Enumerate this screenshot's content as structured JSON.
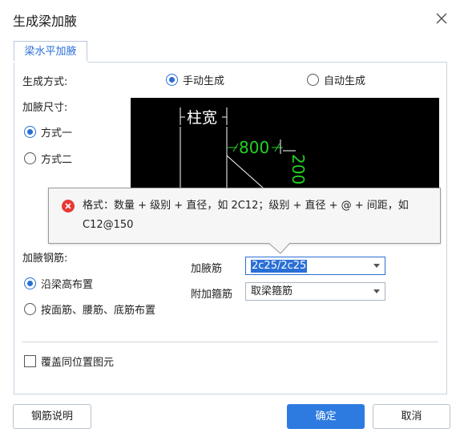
{
  "window": {
    "title": "生成梁加腋"
  },
  "tab": {
    "label": "梁水平加腋"
  },
  "generation": {
    "label": "生成方式:",
    "options": [
      {
        "label": "手动生成",
        "checked": true
      },
      {
        "label": "自动生成",
        "checked": false
      }
    ]
  },
  "haunch_size": {
    "label": "加腋尺寸:",
    "options": [
      {
        "label": "方式一",
        "checked": true
      },
      {
        "label": "方式二",
        "checked": false
      }
    ]
  },
  "preview": {
    "column_width_label": "柱宽",
    "dim_horizontal": "800",
    "dim_vertical": "200"
  },
  "tooltip": {
    "message": "格式：数量 + 级别 + 直径，如 2C12；级别 + 直径 + @ + 间距，如 C12@150"
  },
  "haunch_rebar": {
    "label": "加腋钢筋:",
    "options": [
      {
        "label": "沿梁高布置",
        "checked": true
      },
      {
        "label": "按面筋、腰筋、底筋布置",
        "checked": false
      }
    ],
    "fields": {
      "rebar_label": "加腋筋",
      "rebar_value": "2c25/2c25",
      "stirrup_label": "附加箍筋",
      "stirrup_value": "取梁箍筋"
    }
  },
  "overwrite": {
    "label": "覆盖同位置图元",
    "checked": false
  },
  "buttons": {
    "help": "钢筋说明",
    "ok": "确定",
    "cancel": "取消"
  },
  "colors": {
    "accent": "#2a6fd6",
    "primary_button": "#2d7be0",
    "error": "#e53935",
    "preview_bg": "#000000",
    "preview_dim": "#21d321",
    "preview_line": "#ffffff"
  }
}
